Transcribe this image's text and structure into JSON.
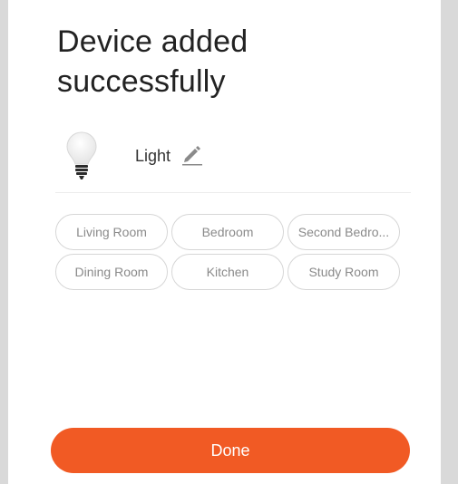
{
  "header": {
    "title": "Device added successfully"
  },
  "device": {
    "name": "Light",
    "icon": "light-bulb-icon",
    "edit_icon": "pencil-icon"
  },
  "rooms": [
    {
      "label": "Living Room"
    },
    {
      "label": "Bedroom"
    },
    {
      "label": "Second Bedro..."
    },
    {
      "label": "Dining Room"
    },
    {
      "label": "Kitchen"
    },
    {
      "label": "Study Room"
    }
  ],
  "actions": {
    "done_label": "Done"
  },
  "colors": {
    "accent": "#f15a24",
    "background": "#d9d9d9",
    "panel": "#ffffff"
  }
}
